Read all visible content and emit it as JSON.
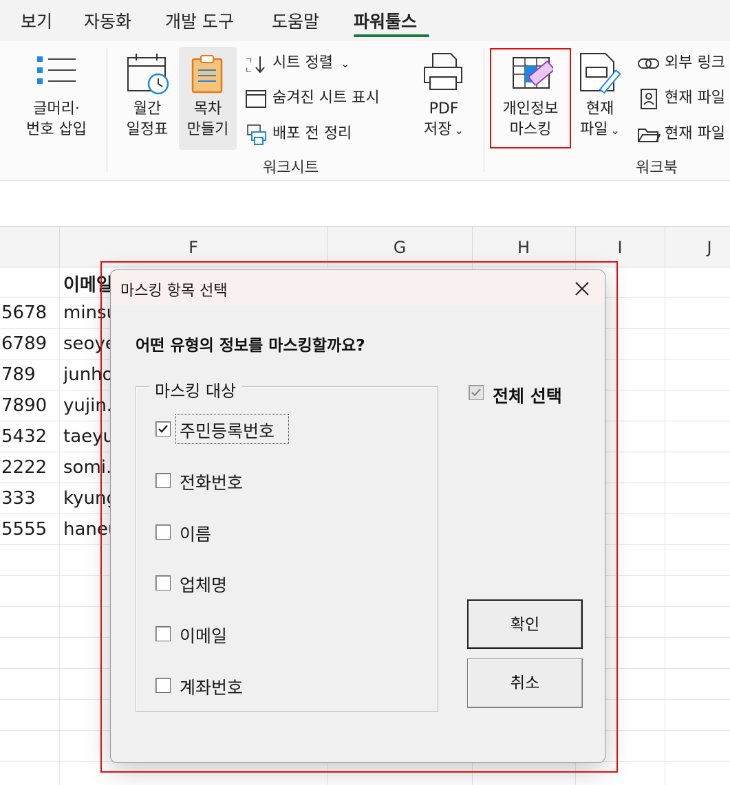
{
  "menu": {
    "tabs": [
      {
        "label": "보기"
      },
      {
        "label": "자동화"
      },
      {
        "label": "개발 도구"
      },
      {
        "label": "도움말"
      },
      {
        "label": "파워툴스",
        "active": true
      }
    ]
  },
  "ribbon": {
    "outline_numbering": {
      "line1": "글머리·",
      "line2": "번호 삽입"
    },
    "monthly_calendar": {
      "line1": "월간",
      "line2": "일정표"
    },
    "make_toc": {
      "line1": "목차",
      "line2": "만들기"
    },
    "sort_sheets": "시트 정렬",
    "show_hidden_sheets": "숨겨진 시트 표시",
    "cleanup_before_distribution": "배포 전 정리",
    "worksheet_group_label": "워크시트",
    "pdf_save": {
      "line1": "PDF",
      "line2": "저장"
    },
    "privacy_masking": {
      "line1": "개인정보",
      "line2": "마스킹"
    },
    "current_file": {
      "line1": "현재",
      "line2": "파일"
    },
    "external_link": "외부 링크",
    "current_file_item1": "현재 파일",
    "current_file_item2": "현재 파일",
    "workbook_group_label": "워크북"
  },
  "sheet": {
    "columns": [
      "F",
      "G",
      "H",
      "I",
      "J"
    ],
    "email_header": "이메일",
    "rows": [
      {
        "phone": "5678",
        "email": "minsu"
      },
      {
        "phone": "6789",
        "email": "seoye"
      },
      {
        "phone": "789",
        "email": "junho"
      },
      {
        "phone": "7890",
        "email": "yujin."
      },
      {
        "phone": "5432",
        "email": "taeyu"
      },
      {
        "phone": "2222",
        "email": "somi."
      },
      {
        "phone": "333",
        "email": "kyung"
      },
      {
        "phone": "5555",
        "email": "haneu"
      }
    ]
  },
  "dialog": {
    "title": "마스킹 항목 선택",
    "question": "어떤 유형의 정보를 마스킹할까요?",
    "group_label": "마스킹 대상",
    "options": [
      {
        "label": "주민등록번호",
        "checked": true
      },
      {
        "label": "전화번호",
        "checked": false
      },
      {
        "label": "이름",
        "checked": false
      },
      {
        "label": "업체명",
        "checked": false
      },
      {
        "label": "이메일",
        "checked": false
      },
      {
        "label": "계좌번호",
        "checked": false
      }
    ],
    "select_all": {
      "label": "전체 선택",
      "checked": true
    },
    "ok_label": "확인",
    "cancel_label": "취소"
  },
  "colors": {
    "accent_green": "#1a7a43",
    "highlight_red": "#e01010",
    "dialog_bg": "#f0f0f0"
  },
  "icons": {
    "outline_numbering": "bulleted-list-icon",
    "monthly_calendar": "calendar-clock-icon",
    "make_toc": "clipboard-list-icon",
    "sort_sheets": "sort-down-icon",
    "show_hidden_sheets": "sheet-window-icon",
    "cleanup": "printer-sheet-icon",
    "pdf_save": "printer-icon",
    "privacy_masking": "grid-eraser-icon",
    "current_file": "file-pen-icon",
    "external_link": "link-icon",
    "current_file_item1": "person-file-icon",
    "current_file_item2": "folder-icon",
    "dialog_close": "close-icon"
  }
}
